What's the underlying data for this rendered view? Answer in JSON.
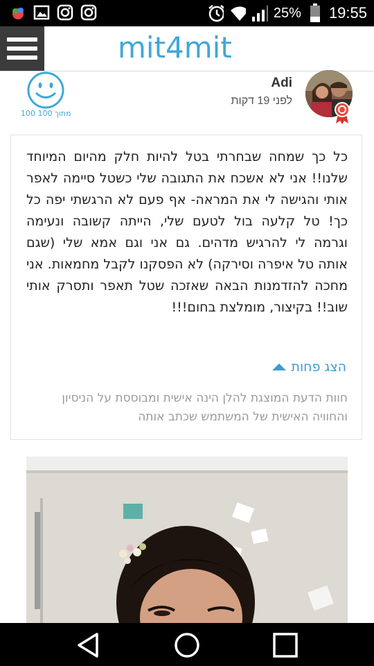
{
  "status_bar": {
    "battery_percent": "25%",
    "time": "19:55",
    "icons": [
      "app-icon",
      "gallery-icon",
      "instagram-icon",
      "instagram-icon",
      "alarm-icon",
      "wifi-icon",
      "signal-icon",
      "battery-icon"
    ]
  },
  "app": {
    "logo": "mit4mit",
    "brand_color": "#3fa8d8"
  },
  "reviewer": {
    "name": "Adi",
    "time_ago": "לפני 19 דקות",
    "score": "100 מתוך 100"
  },
  "review": {
    "text": "כל כך שמחה שבחרתי בטל להיות חלק מהיום המיוחד שלנו!! אני לא אשכח את התגובה שלי כשטל סיימה לאפר אותי והגישה לי את המראה- אף פעם לא הרגשתי יפה כל כך! טל קלעה בול לטעם שלי, הייתה קשובה ונעימה וגרמה לי להרגיש מדהים. גם אני וגם אמא שלי (שגם אותה טל איפרה וסירקה) לא הפסקנו לקבל מחמאות. אני מחכה להזדמנות הבאה שאזכה שטל תאפר ותסרק אותי שוב!! בקיצור, מומלצת בחום!!!",
    "show_less": "הצג פחות",
    "disclaimer": "חוות הדעת המוצגת להלן הינה אישית ומבוססת על הניסיון והחוויה האישית של המשתמש שכתב אותה"
  },
  "navigation": {
    "buttons": [
      "back-icon",
      "home-icon",
      "recents-icon"
    ]
  }
}
